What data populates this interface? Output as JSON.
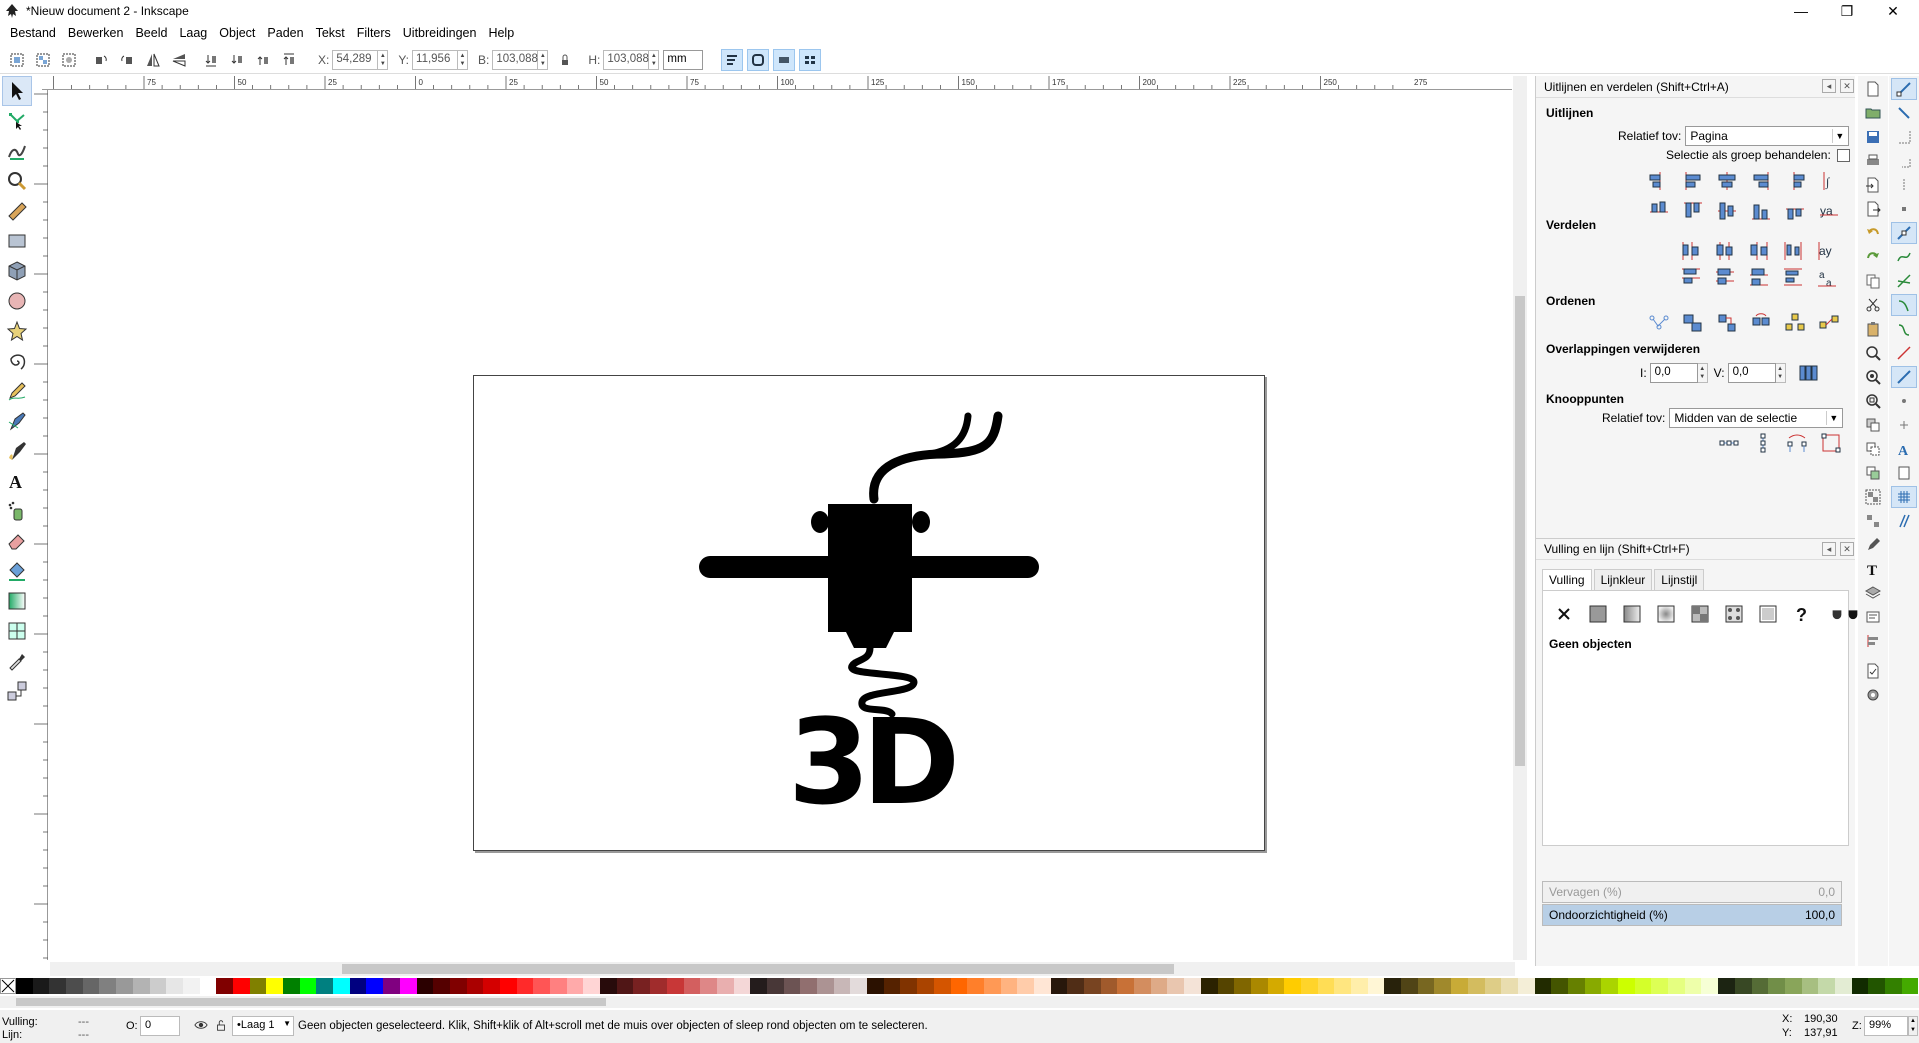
{
  "window": {
    "title": "*Nieuw document 2 - Inkscape",
    "minimize": "—",
    "restore": "❐",
    "close": "✕"
  },
  "menu": [
    "Bestand",
    "Bewerken",
    "Beeld",
    "Laag",
    "Object",
    "Paden",
    "Tekst",
    "Filters",
    "Uitbreidingen",
    "Help"
  ],
  "toolbar": {
    "x_label": "X:",
    "x_value": "54,289",
    "y_label": "Y:",
    "y_value": "11,956",
    "w_label": "B:",
    "w_value": "103,088",
    "h_label": "H:",
    "h_value": "103,088",
    "unit": "mm"
  },
  "ruler": {
    "h_ticks": [
      "75",
      "50",
      "25",
      "0",
      "25",
      "50",
      "75",
      "100",
      "125",
      "150",
      "175",
      "200",
      "225",
      "250",
      "275"
    ]
  },
  "align_panel": {
    "title": "Uitlijnen en verdelen (Shift+Ctrl+A)",
    "uitlijnen": "Uitlijnen",
    "relatief_label": "Relatief tov:",
    "relatief_value": "Pagina",
    "groep_label": "Selectie als groep behandelen:",
    "verdelen": "Verdelen",
    "ordenen": "Ordenen",
    "overlap": "Overlappingen verwijderen",
    "h_label": "I:",
    "h_value": "0,0",
    "v_label": "V:",
    "v_value": "0,0",
    "knooppunten": "Knooppunten",
    "kp_relatief_label": "Relatief tov:",
    "kp_relatief_value": "Midden van de selectie"
  },
  "fill_panel": {
    "title": "Vulling en lijn (Shift+Ctrl+F)",
    "tabs": [
      "Vulling",
      "Lijnkleur",
      "Lijnstijl"
    ],
    "no_objects": "Geen objecten",
    "blur_label": "Vervagen (%)",
    "blur_value": "0,0",
    "opacity_label": "Ondoorzichtigheid (%)",
    "opacity_value": "100,0"
  },
  "status": {
    "fill_label": "Vulling:",
    "fill_value": "---",
    "stroke_label": "Lijn:",
    "stroke_value": "---",
    "o_label": "O:",
    "o_value": "0",
    "layer": "•Laag 1",
    "message": "Geen objecten geselecteerd. Klik, Shift+klik of Alt+scroll met de muis over objecten of sleep rond objecten om te selecteren.",
    "x_label": "X:",
    "x_value": "190,30",
    "y_label": "Y:",
    "y_value": "137,91",
    "z_label": "Z:",
    "zoom": "99%"
  },
  "colors": {
    "accent": "#3a8fd8",
    "active_bg": "#dbe8f7"
  }
}
